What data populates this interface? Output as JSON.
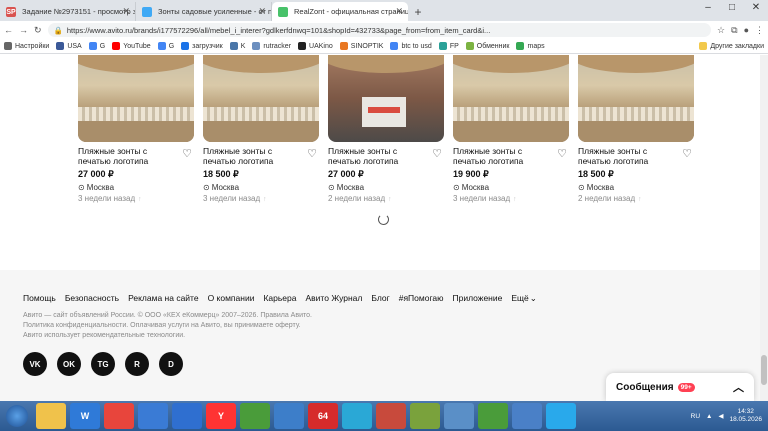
{
  "browser": {
    "tabs": [
      {
        "label": "Задание №2973151 - просмотр з",
        "icon_text": "SP",
        "color": "#d9534f",
        "active": false
      },
      {
        "label": "Зонты садовые усиленные - от п",
        "icon_text": "",
        "color": "#3fa9f5",
        "active": false
      },
      {
        "label": "RealZont - официальная страниц",
        "icon_text": "",
        "color": "#48c26a",
        "active": true
      }
    ],
    "url": "https://www.avito.ru/brands/i177572296/all/mebel_i_interer?gdlkerfdnwq=101&shopId=432733&page_from=from_item_card&i...",
    "bookmarks": [
      {
        "label": "Настройки",
        "color": "#666"
      },
      {
        "label": "USA",
        "color": "#3b5998"
      },
      {
        "label": "G",
        "color": "#4285f4"
      },
      {
        "label": "YouTube",
        "color": "#ff0000"
      },
      {
        "label": "G",
        "color": "#4285f4"
      },
      {
        "label": "загрузчик",
        "color": "#1a73e8"
      },
      {
        "label": "K",
        "color": "#4a76a8"
      },
      {
        "label": "rutracker",
        "color": "#6c8fbf"
      },
      {
        "label": "UAKino",
        "color": "#222"
      },
      {
        "label": "SINOPTIK",
        "color": "#e87722"
      },
      {
        "label": "btc to usd",
        "color": "#4285f4"
      },
      {
        "label": "FP",
        "color": "#2aa198"
      },
      {
        "label": "Обменник",
        "color": "#7cb342"
      },
      {
        "label": "maps",
        "color": "#34a853"
      }
    ],
    "other_bookmarks": "Другие закладки"
  },
  "listings": [
    {
      "title": "Пляжные зонты с печатью логотипа",
      "price": "27 000 ₽",
      "location": "Москва",
      "time": "3 недели назад",
      "dark": false
    },
    {
      "title": "Пляжные зонты с печатью логотипа",
      "price": "18 500 ₽",
      "location": "Москва",
      "time": "3 недели назад",
      "dark": false
    },
    {
      "title": "Пляжные зонты с печатью логотипа",
      "price": "27 000 ₽",
      "location": "Москва",
      "time": "2 недели назад",
      "dark": true
    },
    {
      "title": "Пляжные зонты с печатью логотипа",
      "price": "19 900 ₽",
      "location": "Москва",
      "time": "3 недели назад",
      "dark": false
    },
    {
      "title": "Пляжные зонты с печатью логотипа",
      "price": "18 500 ₽",
      "location": "Москва",
      "time": "2 недели назад",
      "dark": false
    }
  ],
  "footer": {
    "links": [
      "Помощь",
      "Безопасность",
      "Реклама на сайте",
      "О компании",
      "Карьера",
      "Авито Журнал",
      "Блог",
      "#яПомогаю",
      "Приложение",
      "Ещё"
    ],
    "legal_1": "Авито — сайт объявлений России. © ООО «КЕХ еКоммерц» 2007–2026. Правила Авито.",
    "legal_2": "Политика конфиденциальности. Оплачивая услуги на Авито, вы принимаете оферту.",
    "legal_3": "Авито использует рекомендательные технологии.",
    "socials": [
      "VK",
      "OK",
      "TG",
      "R",
      "D"
    ]
  },
  "messages": {
    "label": "Сообщения",
    "badge": "99+"
  },
  "taskbar": {
    "apps": [
      {
        "label": "",
        "color": "#f0c24b"
      },
      {
        "label": "W",
        "color": "#2f7ad8"
      },
      {
        "label": "",
        "color": "#e8453c"
      },
      {
        "label": "",
        "color": "#3a7bd5"
      },
      {
        "label": "",
        "color": "#2f6fd0"
      },
      {
        "label": "Y",
        "color": "#ff3333"
      },
      {
        "label": "",
        "color": "#4a9c3a"
      },
      {
        "label": "",
        "color": "#3d7ec9"
      },
      {
        "label": "64",
        "color": "#d62b2b"
      },
      {
        "label": "",
        "color": "#2aa8d6"
      },
      {
        "label": "",
        "color": "#c84a3c"
      },
      {
        "label": "",
        "color": "#7aa23c"
      },
      {
        "label": "",
        "color": "#5a8fc7"
      },
      {
        "label": "",
        "color": "#4a9c3a"
      },
      {
        "label": "",
        "color": "#4a80c7"
      },
      {
        "label": "",
        "color": "#29a9eb"
      }
    ],
    "lang": "RU",
    "time": "14:32",
    "date": "18.05.2026"
  }
}
